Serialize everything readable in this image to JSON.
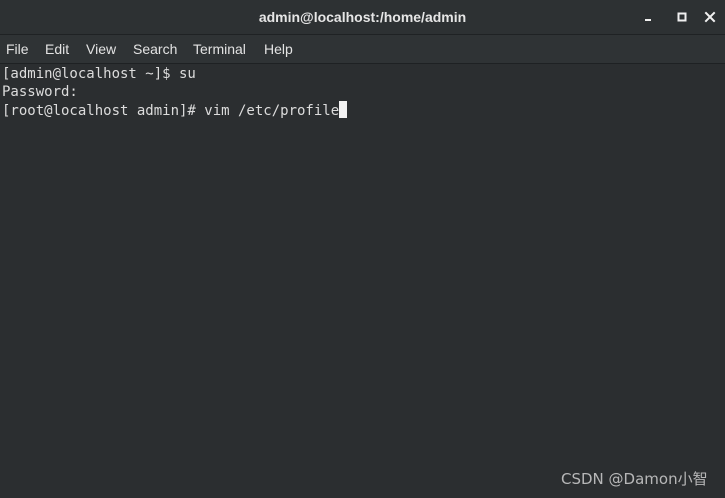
{
  "window": {
    "title": "admin@localhost:/home/admin",
    "controls": {
      "minimize_icon": "minimize-icon",
      "maximize_icon": "maximize-icon",
      "close_icon": "close-icon"
    }
  },
  "menu": {
    "items": [
      {
        "label": "File"
      },
      {
        "label": "Edit"
      },
      {
        "label": "View"
      },
      {
        "label": "Search"
      },
      {
        "label": "Terminal"
      },
      {
        "label": "Help"
      }
    ]
  },
  "terminal": {
    "lines": [
      "[admin@localhost ~]$ su",
      "Password: ",
      "[root@localhost admin]# vim /etc/profile"
    ],
    "background": "#2b2e30",
    "foreground": "#dcdcdc",
    "cursor_color": "#f2f2f2"
  },
  "watermark": {
    "text": "CSDN @Damon小智"
  }
}
